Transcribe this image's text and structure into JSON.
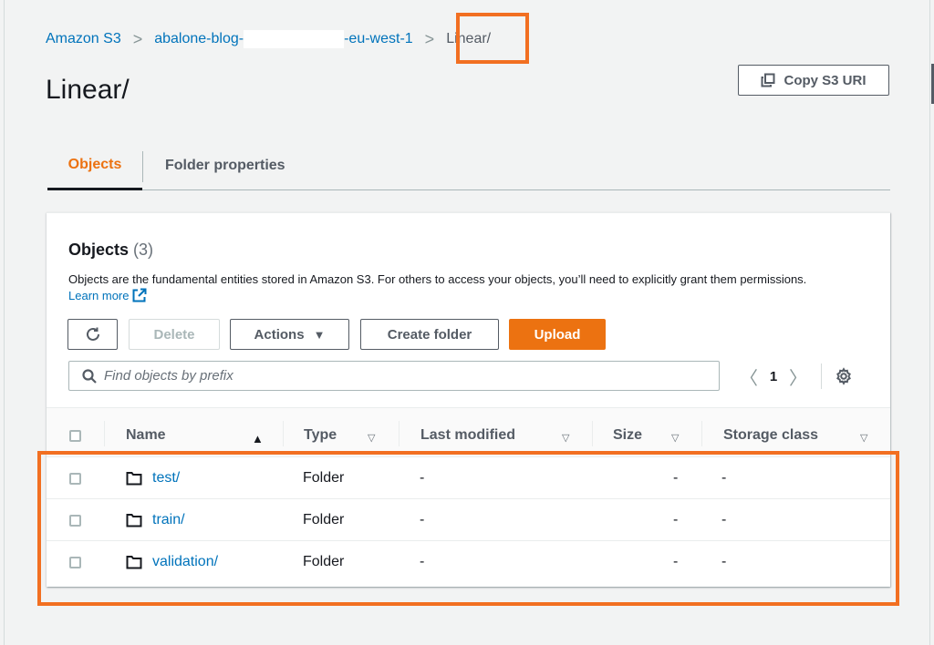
{
  "breadcrumb": {
    "items": [
      {
        "label": "Amazon S3"
      },
      {
        "label_prefix": "abalone-blog-",
        "label_suffix": "-eu-west-1"
      },
      {
        "label": "Linear/"
      }
    ],
    "separator": ">"
  },
  "page": {
    "title": "Linear/",
    "copy_uri_label": "Copy S3 URI"
  },
  "tabs": [
    {
      "label": "Objects",
      "active": true
    },
    {
      "label": "Folder properties",
      "active": false
    }
  ],
  "objects_panel": {
    "title": "Objects",
    "count": "(3)",
    "description": "Objects are the fundamental entities stored in Amazon S3. For others to access your objects, you’ll need to explicitly grant them permissions.",
    "learn_more": "Learn more"
  },
  "toolbar": {
    "delete_label": "Delete",
    "actions_label": "Actions",
    "actions_caret": "▼",
    "create_folder_label": "Create folder",
    "upload_label": "Upload"
  },
  "search": {
    "placeholder": "Find objects by prefix",
    "value": ""
  },
  "pagination": {
    "prev": "〈",
    "current_page": "1",
    "next": "〉"
  },
  "table": {
    "columns": [
      {
        "label": "Name",
        "sort": "▲"
      },
      {
        "label": "Type",
        "sort": "▽"
      },
      {
        "label": "Last modified",
        "sort": "▽"
      },
      {
        "label": "Size",
        "sort": "▽"
      },
      {
        "label": "Storage class",
        "sort": "▽"
      }
    ],
    "rows": [
      {
        "name": "test/",
        "type": "Folder",
        "last_modified": "-",
        "size": "-",
        "storage_class": "-"
      },
      {
        "name": "train/",
        "type": "Folder",
        "last_modified": "-",
        "size": "-",
        "storage_class": "-"
      },
      {
        "name": "validation/",
        "type": "Folder",
        "last_modified": "-",
        "size": "-",
        "storage_class": "-"
      }
    ]
  },
  "colors": {
    "link": "#0073bb",
    "primary": "#ec7211",
    "highlight": "#f26f21",
    "text": "#16191f",
    "muted": "#545b64",
    "border": "#aab7b8",
    "background": "#f2f3f3"
  },
  "icons": {
    "refresh": "refresh-icon",
    "copy": "copy-icon",
    "external_link": "external-link-icon",
    "search": "search-icon",
    "settings": "gear-icon",
    "folder": "folder-icon"
  }
}
